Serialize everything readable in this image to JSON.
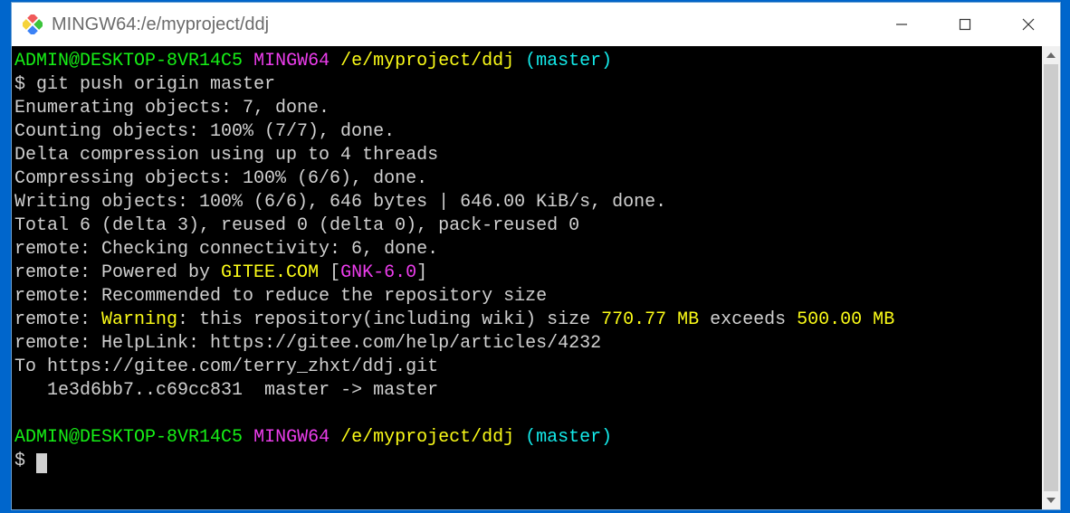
{
  "window": {
    "title": "MINGW64:/e/myproject/ddj"
  },
  "prompt1": {
    "userhost": "ADMIN@DESKTOP-8VR14C5",
    "env": "MINGW64",
    "path": "/e/myproject/ddj",
    "branch": "(master)"
  },
  "cmd1": "$ git push origin master",
  "out": {
    "l1": "Enumerating objects: 7, done.",
    "l2": "Counting objects: 100% (7/7), done.",
    "l3": "Delta compression using up to 4 threads",
    "l4": "Compressing objects: 100% (6/6), done.",
    "l5": "Writing objects: 100% (6/6), 646 bytes | 646.00 KiB/s, done.",
    "l6": "Total 6 (delta 3), reused 0 (delta 0), pack-reused 0",
    "l7": "remote: Checking connectivity: 6, done.",
    "l8a": "remote: Powered by ",
    "l8b": "GITEE.COM",
    "l8c": " [",
    "l8d": "GNK-6.0",
    "l8e": "]",
    "l9": "remote: Recommended to reduce the repository size",
    "l10a": "remote: ",
    "l10b": "Warning",
    "l10c": ": this repository(including wiki) size ",
    "l10d": "770.77 MB",
    "l10e": " exceeds ",
    "l10f": "500.00 MB",
    "l11": "remote: HelpLink: https://gitee.com/help/articles/4232",
    "l12": "To https://gitee.com/terry_zhxt/ddj.git",
    "l13": "   1e3d6bb7..c69cc831  master -> master"
  },
  "prompt2": {
    "userhost": "ADMIN@DESKTOP-8VR14C5",
    "env": "MINGW64",
    "path": "/e/myproject/ddj",
    "branch": "(master)"
  },
  "cmd2": "$ ",
  "scrollbar": {
    "thumb_top_pct": 4,
    "thumb_height_pct": 92
  }
}
